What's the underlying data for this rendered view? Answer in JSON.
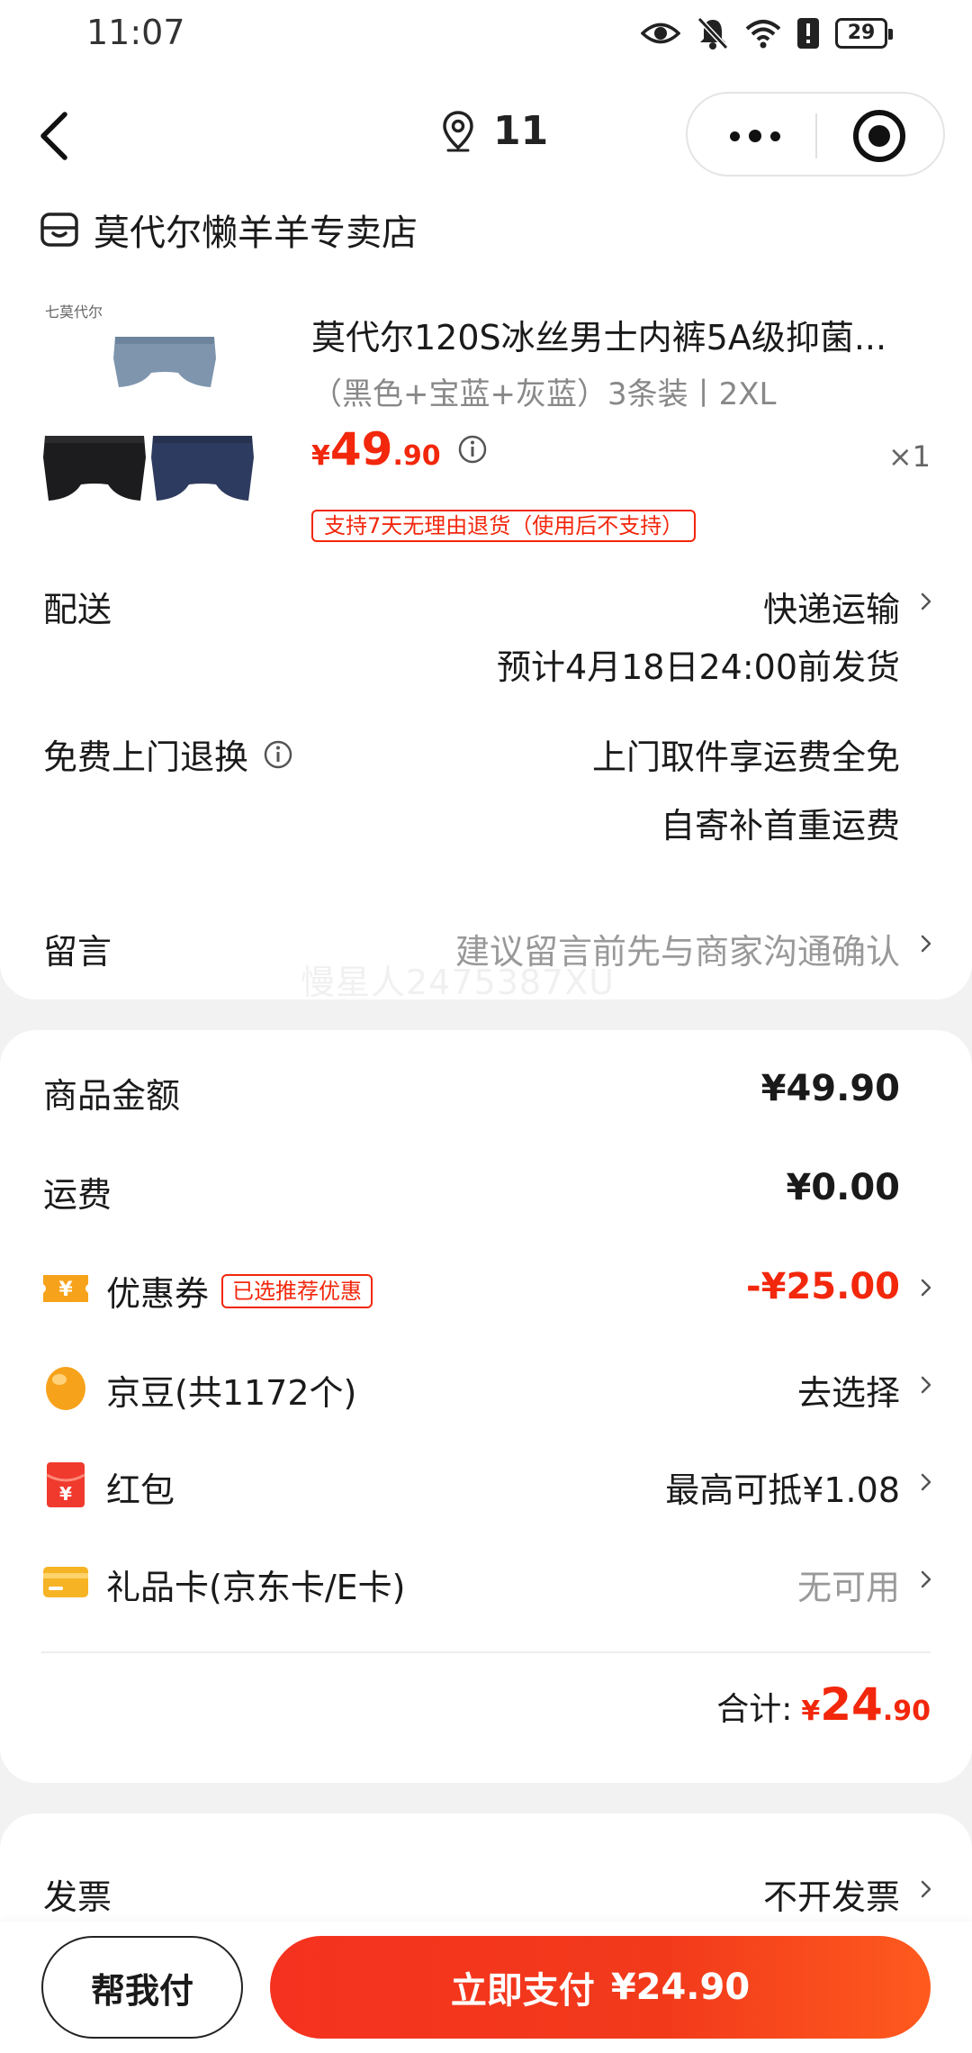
{
  "status_bar": {
    "time": "11:07",
    "battery": "29"
  },
  "nav": {
    "location_count": "11"
  },
  "shop": {
    "name": "莫代尔懒羊羊专卖店"
  },
  "product": {
    "image_brand_text": "七莫代尔",
    "title": "莫代尔120S冰丝男士内裤5A级抑菌...",
    "spec": "（黑色+宝蓝+灰蓝）3条装丨2XL",
    "price_symbol": "¥",
    "price_int": "49",
    "price_dec": ".90",
    "quantity": "×1",
    "return_policy": "支持7天无理由退货（使用后不支持）"
  },
  "delivery": {
    "label": "配送",
    "method": "快递运输",
    "estimate": "预计4月18日24:00前发货"
  },
  "free_return": {
    "label": "免费上门退换",
    "line1": "上门取件享运费全免",
    "line2": "自寄补首重运费"
  },
  "message": {
    "label": "留言",
    "placeholder": "建议留言前先与商家沟通确认"
  },
  "watermark": "慢星人2475387XU",
  "summary": {
    "goods_label": "商品金额",
    "goods_amount": "¥49.90",
    "shipping_label": "运费",
    "shipping_amount": "¥0.00",
    "coupon_label": "优惠券",
    "coupon_tag": "已选推荐优惠",
    "coupon_amount": "-¥25.00",
    "jingdou_label": "京豆(共1172个)",
    "jingdou_action": "去选择",
    "redpacket_label": "红包",
    "redpacket_value": "最高可抵¥1.08",
    "giftcard_label": "礼品卡(京东卡/E卡)",
    "giftcard_value": "无可用",
    "total_label": "合计:",
    "total_symbol": "¥",
    "total_int": "24",
    "total_dec": ".90"
  },
  "invoice": {
    "label": "发票",
    "value": "不开发票"
  },
  "bottom": {
    "help_pay": "帮我付",
    "pay_now": "立即支付",
    "pay_amount": "¥24.90"
  },
  "colors": {
    "accent_red": "#f2270c",
    "coupon_icon": "#f7a21b",
    "jingdou_icon": "#f7a21b",
    "redpacket_icon": "#f03a2e",
    "giftcard_icon": "#f6b324"
  },
  "icons": {
    "status": [
      "eye-icon",
      "bell-muted-icon",
      "wifi-icon",
      "alert-icon",
      "battery-icon"
    ],
    "nav": [
      "back-arrow-icon",
      "location-pin-icon",
      "more-dots-icon",
      "close-circle-icon"
    ],
    "shop": "store-icon",
    "summary": [
      "coupon-icon",
      "jingdou-icon",
      "redpacket-icon",
      "giftcard-icon"
    ]
  }
}
